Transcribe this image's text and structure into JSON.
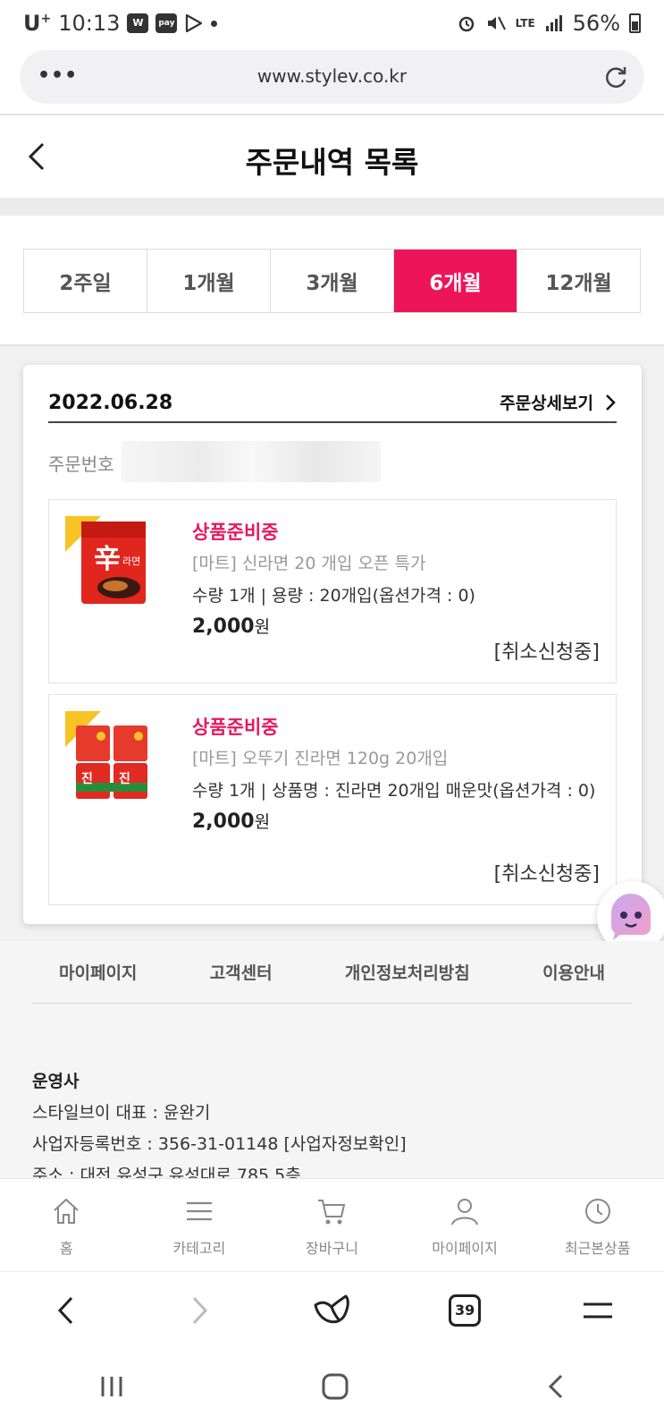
{
  "status_bar": {
    "carrier": "U",
    "carrier_sup": "+",
    "time": "10:13",
    "app_w": "W",
    "app_pay": "pay",
    "network": "LTE",
    "battery": "56%"
  },
  "browser": {
    "url": "www.stylev.co.kr",
    "menu_glyph": "•••",
    "tabs_count": "39"
  },
  "header": {
    "title": "주문내역 목록"
  },
  "period_tabs": [
    {
      "label": "2주일",
      "active": false
    },
    {
      "label": "1개월",
      "active": false
    },
    {
      "label": "3개월",
      "active": false
    },
    {
      "label": "6개월",
      "active": true
    },
    {
      "label": "12개월",
      "active": false
    }
  ],
  "order": {
    "date": "2022.06.28",
    "detail_link": "주문상세보기",
    "order_no_label": "주문번호",
    "items": [
      {
        "status": "상품준비중",
        "name": "[마트] 신라면 20 개입 오픈 특가",
        "option": "수량 1개  | 용량 : 20개입(옵션가격 : 0)",
        "price": "2,000",
        "currency": "원",
        "cancel_status": "[취소신청중]"
      },
      {
        "status": "상품준비중",
        "name": "[마트] 오뚜기 진라면 120g 20개입",
        "option": "수량 1개  | 상품명 : 진라면 20개입 매운맛(옵션가격 : 0)",
        "price": "2,000",
        "currency": "원",
        "cancel_status": "[취소신청중]"
      }
    ]
  },
  "footer": {
    "links": [
      "마이페이지",
      "고객센터",
      "개인정보처리방침",
      "이용안내"
    ],
    "company_title": "운영사",
    "company_line1": "스타일브이 대표 : 윤완기",
    "company_line2": "사업자등록번호 : 356-31-01148 [사업자정보확인]",
    "company_line3": "주소 : 대전 유성구 유성대로 785 5층"
  },
  "bottom_nav": [
    {
      "label": "홈",
      "icon": "home-icon"
    },
    {
      "label": "카테고리",
      "icon": "menu-icon"
    },
    {
      "label": "장바구니",
      "icon": "cart-icon"
    },
    {
      "label": "마이페이지",
      "icon": "user-icon"
    },
    {
      "label": "최근본상품",
      "icon": "clock-icon"
    }
  ],
  "colors": {
    "accent": "#ee1459",
    "status_pink": "#e8175d"
  }
}
